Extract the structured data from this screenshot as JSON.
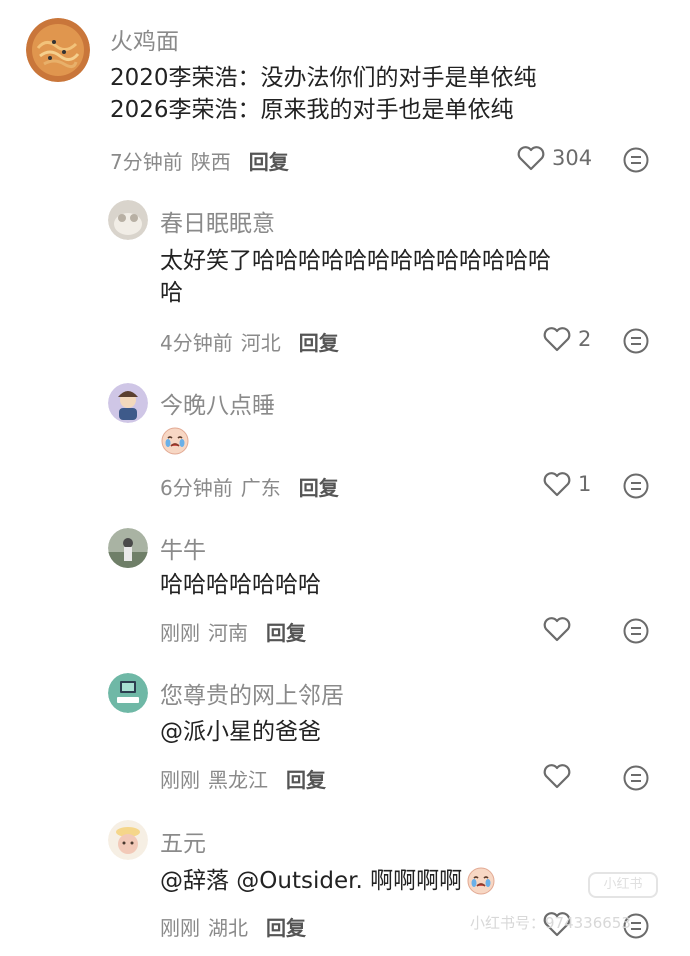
{
  "comments": [
    {
      "user": "火鸡面",
      "lines": [
        "2020李荣浩：没办法你们的对手是单依纯",
        "2026李荣浩：原来我的对手也是单依纯"
      ],
      "time": "7分钟前",
      "location": "陕西",
      "reply": "回复",
      "likes": "304",
      "avatar_icon": "noodles-avatar"
    },
    {
      "user": "春日眠眠意",
      "lines": [
        "太好笑了哈哈哈哈哈哈哈哈哈哈哈哈哈",
        "哈"
      ],
      "time": "4分钟前",
      "location": "河北",
      "reply": "回复",
      "likes": "2",
      "avatar_icon": "cat-avatar"
    },
    {
      "user": "今晚八点睡",
      "emoji": "crying-face-sticker",
      "time": "6分钟前",
      "location": "广东",
      "reply": "回复",
      "likes": "1",
      "avatar_icon": "cartoon-avatar"
    },
    {
      "user": "牛牛",
      "lines": [
        "哈哈哈哈哈哈哈"
      ],
      "time": "刚刚",
      "location": "河南",
      "reply": "回复",
      "likes": "",
      "avatar_icon": "figure-avatar"
    },
    {
      "user": "您尊贵的网上邻居",
      "lines": [
        "@派小星的爸爸"
      ],
      "time": "刚刚",
      "location": "黑龙江",
      "reply": "回复",
      "likes": "",
      "avatar_icon": "computer-avatar"
    },
    {
      "user": "五元",
      "lines": [
        "@辞落  @Outsider.  啊啊啊啊"
      ],
      "time": "刚刚",
      "location": "湖北",
      "reply": "回复",
      "likes": "",
      "avatar_icon": "bear-avatar"
    }
  ],
  "watermark": {
    "text": "小红书号：974336653",
    "logo": "小红书"
  },
  "colors": {
    "muted": "#8a8a8a",
    "text": "#222222",
    "icon": "#6b6b6b"
  }
}
